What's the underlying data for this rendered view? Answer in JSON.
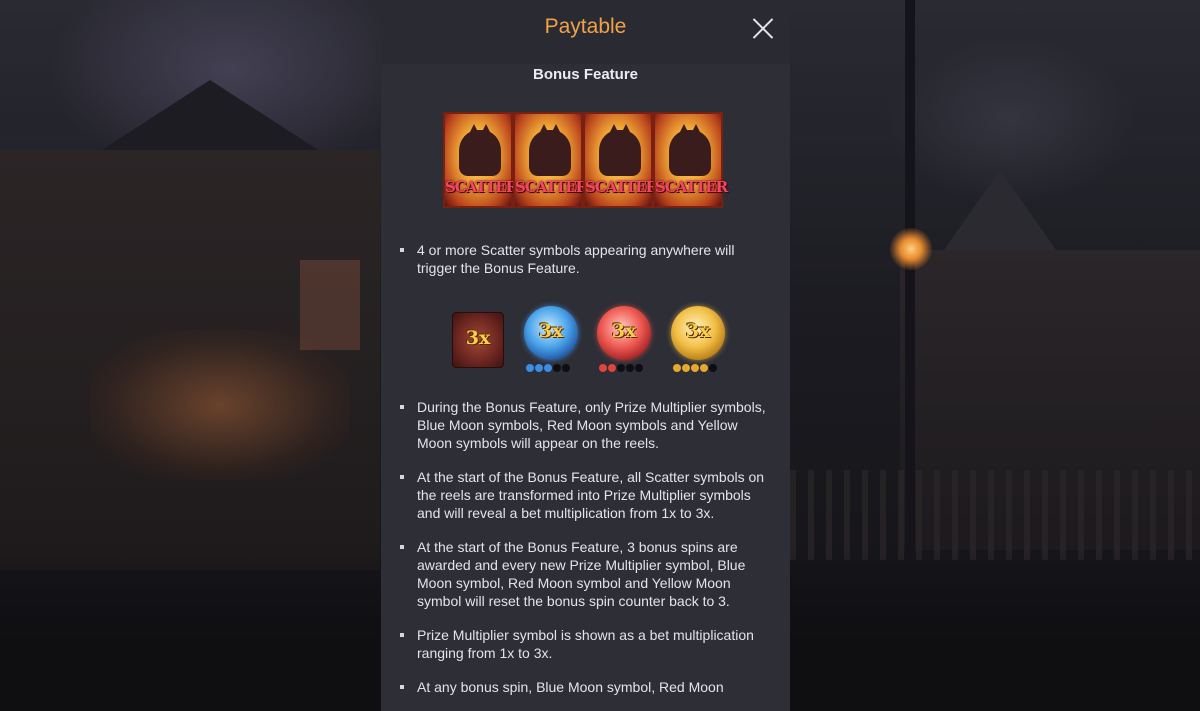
{
  "dialog": {
    "title": "Paytable",
    "section_title": "Bonus Feature"
  },
  "scatter_symbols": [
    "SCATTER",
    "SCATTER",
    "SCATTER",
    "SCATTER"
  ],
  "bullets_top": [
    "4 or more Scatter symbols appearing anywhere will trigger the Bonus Feature."
  ],
  "bonus_symbols": {
    "prize_multiplier": "3x",
    "blue_moon": "3x",
    "red_moon": "3x",
    "yellow_moon": "3x"
  },
  "colors": {
    "title": "#f0a24a",
    "panel_bg": "#2d2e36",
    "scatter_text": "#f4446a",
    "blue_dot": "#3a8ee6",
    "red_dot": "#e0443c",
    "yellow_dot": "#e8a82e",
    "empty_dot": "#0e0e12"
  },
  "bullets_main": [
    "During the Bonus Feature, only Prize Multiplier symbols, Blue Moon symbols, Red Moon symbols and Yellow Moon symbols will appear on the reels.",
    "At the start of the Bonus Feature, all Scatter symbols on the reels are transformed into Prize Multiplier symbols and will reveal a bet multiplication from 1x to 3x.",
    "At the start of the Bonus Feature, 3 bonus spins are awarded and every new Prize Multiplier symbol, Blue Moon symbol, Red Moon symbol and Yellow Moon symbol will reset the bonus spin counter back to 3.",
    "Prize Multiplier symbol is shown as a bet multiplication ranging from 1x to 3x.",
    "At any bonus spin, Blue Moon symbol, Red Moon"
  ]
}
